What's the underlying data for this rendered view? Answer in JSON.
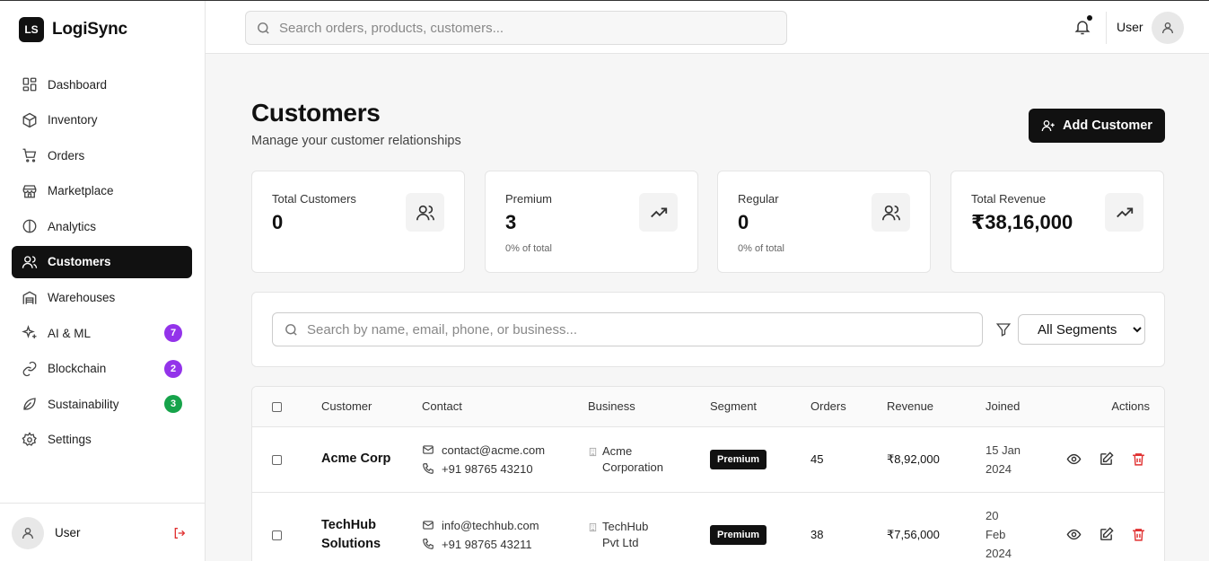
{
  "app": {
    "logo_text": "LS",
    "name": "LogiSync"
  },
  "sidebar": {
    "items": [
      {
        "label": "Dashboard",
        "icon": "dashboard-icon",
        "badge": ""
      },
      {
        "label": "Inventory",
        "icon": "package-icon",
        "badge": ""
      },
      {
        "label": "Orders",
        "icon": "cart-icon",
        "badge": ""
      },
      {
        "label": "Marketplace",
        "icon": "store-icon",
        "badge": ""
      },
      {
        "label": "Analytics",
        "icon": "pie-chart-icon",
        "badge": ""
      },
      {
        "label": "Customers",
        "icon": "users-icon",
        "badge": "",
        "active": true
      },
      {
        "label": "Warehouses",
        "icon": "warehouse-icon",
        "badge": ""
      },
      {
        "label": "AI & ML",
        "icon": "sparkles-icon",
        "badge": "7",
        "badge_color": "#9333ea"
      },
      {
        "label": "Blockchain",
        "icon": "link-icon",
        "badge": "2",
        "badge_color": "#9333ea"
      },
      {
        "label": "Sustainability",
        "icon": "leaf-icon",
        "badge": "3",
        "badge_color": "#16a34a"
      },
      {
        "label": "Settings",
        "icon": "gear-icon",
        "badge": ""
      }
    ],
    "footer_user": "User"
  },
  "topbar": {
    "search_placeholder": "Search orders, products, customers...",
    "user_label": "User"
  },
  "page": {
    "title": "Customers",
    "subtitle": "Manage your customer relationships",
    "add_button": "Add Customer"
  },
  "stats": [
    {
      "label": "Total Customers",
      "value": "0",
      "sub": "",
      "icon": "users-icon"
    },
    {
      "label": "Premium",
      "value": "3",
      "sub": "0% of total",
      "icon": "trending-up-icon"
    },
    {
      "label": "Regular",
      "value": "0",
      "sub": "0% of total",
      "icon": "users-icon"
    },
    {
      "label": "Total Revenue",
      "value": "₹38,16,000",
      "sub": "",
      "icon": "trending-up-icon"
    }
  ],
  "filters": {
    "search_placeholder": "Search by name, email, phone, or business...",
    "segment_selected": "All Segments"
  },
  "table": {
    "columns": [
      "Customer",
      "Contact",
      "Business",
      "Segment",
      "Orders",
      "Revenue",
      "Joined",
      "Actions"
    ],
    "rows": [
      {
        "name": "Acme Corp",
        "email": "contact@acme.com",
        "phone": "+91 98765 43210",
        "business": "Acme Corporation",
        "segment": "Premium",
        "orders": "45",
        "revenue": "₹8,92,000",
        "joined": "15 Jan 2024"
      },
      {
        "name": "TechHub Solutions",
        "email": "info@techhub.com",
        "phone": "+91 98765 43211",
        "business": "TechHub Pvt Ltd",
        "segment": "Premium",
        "orders": "38",
        "revenue": "₹7,56,000",
        "joined": "20 Feb 2024"
      }
    ]
  },
  "colors": {
    "primary": "#111111",
    "danger": "#e03131",
    "purple_badge": "#9333ea",
    "green_badge": "#16a34a"
  }
}
